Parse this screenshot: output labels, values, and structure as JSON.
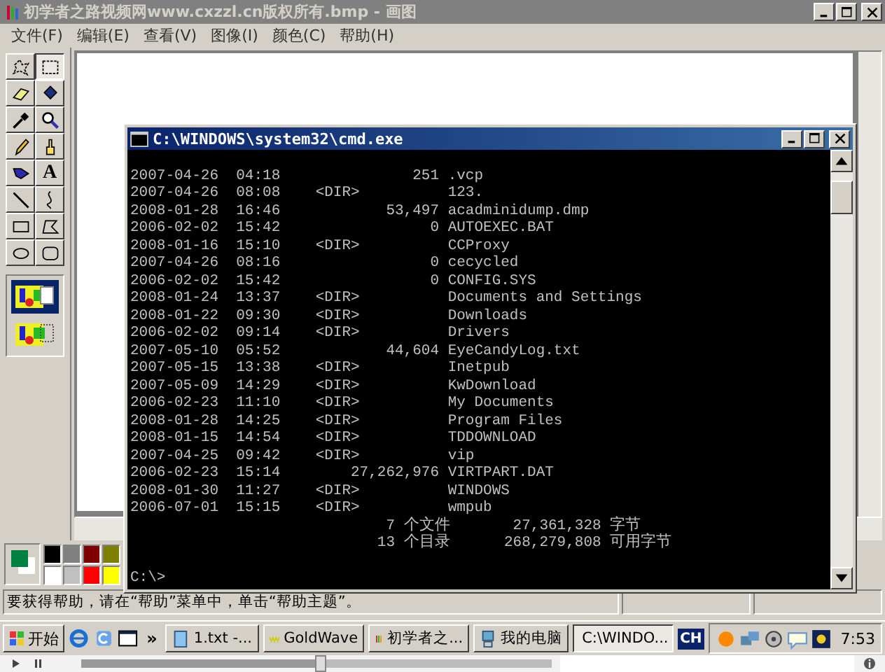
{
  "window": {
    "title": "初学者之路视频网www.cxzzl.cn版权所有.bmp - 画图"
  },
  "menu": [
    "文件(F)",
    "编辑(E)",
    "查看(V)",
    "图像(I)",
    "颜色(C)",
    "帮助(H)"
  ],
  "tools": [
    {
      "kind": "free-select",
      "selected": false
    },
    {
      "kind": "rect-select",
      "selected": true
    },
    {
      "kind": "eraser",
      "selected": false
    },
    {
      "kind": "fill",
      "selected": false
    },
    {
      "kind": "picker",
      "selected": false
    },
    {
      "kind": "magnifier",
      "selected": false
    },
    {
      "kind": "pencil",
      "selected": false
    },
    {
      "kind": "brush",
      "selected": false
    },
    {
      "kind": "airbrush",
      "selected": false
    },
    {
      "kind": "text",
      "glyph": "A",
      "selected": false
    },
    {
      "kind": "line",
      "selected": false
    },
    {
      "kind": "curve",
      "selected": false
    },
    {
      "kind": "rectangle",
      "selected": false
    },
    {
      "kind": "polygon",
      "selected": false
    },
    {
      "kind": "ellipse",
      "selected": false
    },
    {
      "kind": "rounded-rectangle",
      "selected": false
    }
  ],
  "tool_options": [
    {
      "kind": "opaque",
      "selected": true
    },
    {
      "kind": "transparent",
      "selected": false
    }
  ],
  "palette": {
    "colors": [
      {
        "color": "#000000"
      },
      {
        "color": "#808080"
      },
      {
        "color": "#800000"
      },
      {
        "color": "#808000"
      },
      {
        "color": "#ffffff"
      },
      {
        "color": "#c0c0c0"
      },
      {
        "color": "#ff0000"
      },
      {
        "color": "#ffff00"
      }
    ]
  },
  "status_bar": {
    "text": "要获得帮助，请在“帮助”菜单中，单击“帮助主题”。"
  },
  "console": {
    "title": "C:\\WINDOWS\\system32\\cmd.exe",
    "entries": [
      {
        "date": "2007-04-26",
        "time": "04:18",
        "kind": "file",
        "size": "251",
        "name": ".vcp"
      },
      {
        "date": "2007-04-26",
        "time": "08:08",
        "kind": "dir",
        "size": "<DIR>",
        "name": "123."
      },
      {
        "date": "2008-01-28",
        "time": "16:46",
        "kind": "file",
        "size": "53,497",
        "name": "acadminidump.dmp"
      },
      {
        "date": "2006-02-02",
        "time": "15:42",
        "kind": "file",
        "size": "0",
        "name": "AUTOEXEC.BAT"
      },
      {
        "date": "2008-01-16",
        "time": "15:10",
        "kind": "dir",
        "size": "<DIR>",
        "name": "CCProxy"
      },
      {
        "date": "2007-04-26",
        "time": "08:16",
        "kind": "file",
        "size": "0",
        "name": "cecycled"
      },
      {
        "date": "2006-02-02",
        "time": "15:42",
        "kind": "file",
        "size": "0",
        "name": "CONFIG.SYS"
      },
      {
        "date": "2008-01-24",
        "time": "13:37",
        "kind": "dir",
        "size": "<DIR>",
        "name": "Documents and Settings"
      },
      {
        "date": "2008-01-22",
        "time": "09:30",
        "kind": "dir",
        "size": "<DIR>",
        "name": "Downloads"
      },
      {
        "date": "2006-02-02",
        "time": "09:14",
        "kind": "dir",
        "size": "<DIR>",
        "name": "Drivers"
      },
      {
        "date": "2007-05-10",
        "time": "05:52",
        "kind": "file",
        "size": "44,604",
        "name": "EyeCandyLog.txt"
      },
      {
        "date": "2007-05-15",
        "time": "13:38",
        "kind": "dir",
        "size": "<DIR>",
        "name": "Inetpub"
      },
      {
        "date": "2007-05-09",
        "time": "14:29",
        "kind": "dir",
        "size": "<DIR>",
        "name": "KwDownload"
      },
      {
        "date": "2006-02-23",
        "time": "11:10",
        "kind": "dir",
        "size": "<DIR>",
        "name": "My Documents"
      },
      {
        "date": "2008-01-28",
        "time": "14:25",
        "kind": "dir",
        "size": "<DIR>",
        "name": "Program Files"
      },
      {
        "date": "2008-01-15",
        "time": "14:54",
        "kind": "dir",
        "size": "<DIR>",
        "name": "TDDOWNLOAD"
      },
      {
        "date": "2007-04-25",
        "time": "09:42",
        "kind": "dir",
        "size": "<DIR>",
        "name": "vip"
      },
      {
        "date": "2006-02-23",
        "time": "15:14",
        "kind": "file",
        "size": "27,262,976",
        "name": "VIRTPART.DAT"
      },
      {
        "date": "2008-01-30",
        "time": "11:27",
        "kind": "dir",
        "size": "<DIR>",
        "name": "WINDOWS"
      },
      {
        "date": "2006-07-01",
        "time": "15:15",
        "kind": "dir",
        "size": "<DIR>",
        "name": "wmpub"
      }
    ],
    "summary": [
      {
        "count": "7",
        "label": "个文件",
        "bytes": "27,361,328",
        "unit": "字节"
      },
      {
        "count": "13",
        "label": "个目录",
        "bytes": "268,279,808",
        "unit": "可用字节"
      }
    ],
    "prompt": "C:\\>"
  },
  "taskbar": {
    "start": "开始",
    "more": "»",
    "tasks": [
      {
        "kind": "notepad",
        "label": "1.txt -...",
        "selected": false
      },
      {
        "kind": "goldwave",
        "label": "GoldWave",
        "selected": false
      },
      {
        "kind": "paint",
        "label": "初学者之...",
        "selected": false
      },
      {
        "kind": "computer",
        "label": "我的电脑",
        "selected": false
      },
      {
        "kind": "console",
        "label": "C:\\WINDO...",
        "selected": true
      }
    ],
    "language": "CH",
    "clock": "7:53"
  },
  "player": {
    "level": 0.51
  }
}
